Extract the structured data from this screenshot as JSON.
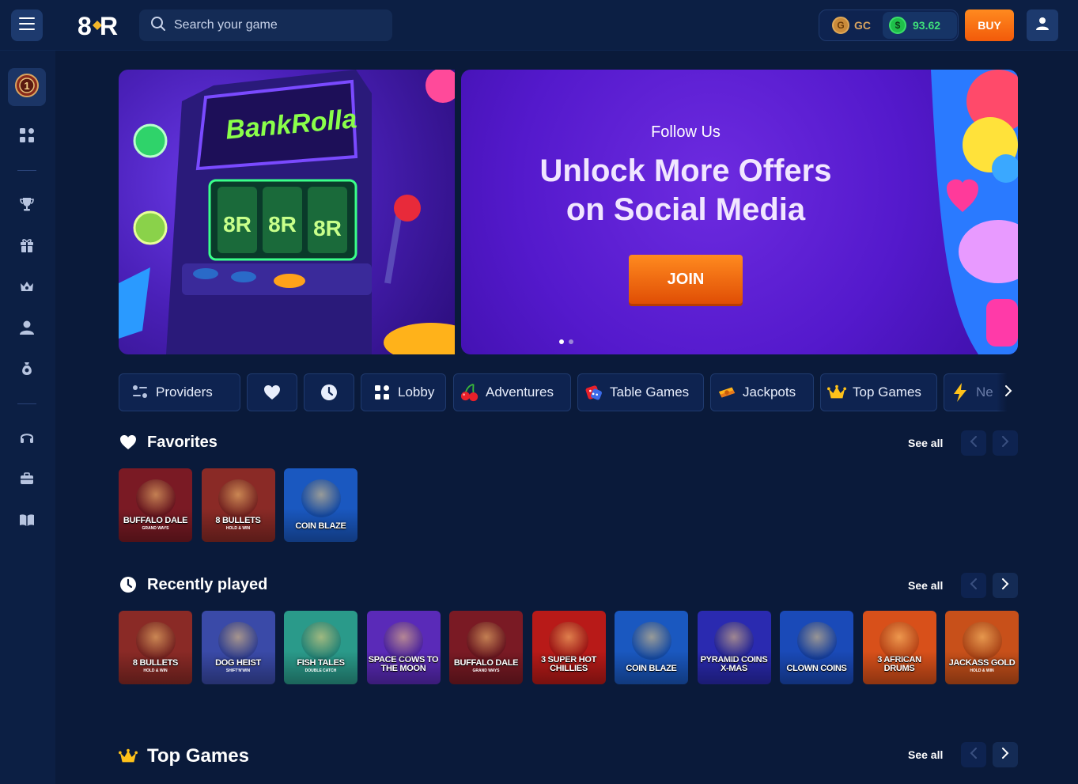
{
  "header": {
    "search_placeholder": "Search your game",
    "gc_label": "GC",
    "sc_value": "93.62",
    "buy_label": "BUY",
    "logo_text": "8R"
  },
  "sidebar": {
    "icons": [
      "vip-badge-icon",
      "grid-icon",
      "trophy-icon",
      "gift-icon",
      "crown-basket-icon",
      "user-icon",
      "money-bag-icon",
      "headset-icon",
      "briefcase-icon",
      "book-icon"
    ]
  },
  "banner": {
    "left_title": "BankRolla",
    "follow": "Follow Us",
    "headline_line1": "Unlock More Offers",
    "headline_line2": "on Social Media",
    "join_label": "JOIN"
  },
  "tabs": [
    {
      "label": "Providers",
      "icon": "providers-icon"
    },
    {
      "label": "",
      "icon": "heart-icon"
    },
    {
      "label": "",
      "icon": "clock-icon"
    },
    {
      "label": "Lobby",
      "icon": "grid-icon"
    },
    {
      "label": "Adventures",
      "icon": "cherries-icon"
    },
    {
      "label": "Table Games",
      "icon": "dice-icon"
    },
    {
      "label": "Jackpots",
      "icon": "cash-icon"
    },
    {
      "label": "Top Games",
      "icon": "crown-icon"
    },
    {
      "label": "Ne",
      "icon": "lightning-icon"
    }
  ],
  "favorites": {
    "title": "Favorites",
    "see_all": "See all",
    "games": [
      {
        "name": "BUFFALO DALE",
        "sub": "GRAND WAYS",
        "bg": "#7a1a24"
      },
      {
        "name": "8 BULLETS",
        "sub": "HOLD & WIN",
        "bg": "#8a2a26"
      },
      {
        "name": "COIN BLAZE",
        "sub": "",
        "bg": "#1a58c0"
      }
    ]
  },
  "recent": {
    "title": "Recently played",
    "see_all": "See all",
    "games": [
      {
        "name": "8 BULLETS",
        "sub": "HOLD & WIN",
        "bg": "#8a2a26"
      },
      {
        "name": "DOG HEIST",
        "sub": "SHIFT'N'WIN",
        "bg": "#3a4aa8"
      },
      {
        "name": "FISH TALES",
        "sub": "DOUBLE CATCH",
        "bg": "#2a9a8a"
      },
      {
        "name": "SPACE COWS TO THE MOON",
        "sub": "",
        "bg": "#5a2ab8"
      },
      {
        "name": "BUFFALO DALE",
        "sub": "GRAND WAYS",
        "bg": "#7a1a24"
      },
      {
        "name": "3 SUPER HOT CHILLIES",
        "sub": "",
        "bg": "#b81a18"
      },
      {
        "name": "COIN BLAZE",
        "sub": "",
        "bg": "#1a58c0"
      },
      {
        "name": "PYRAMID COINS X-MAS",
        "sub": "",
        "bg": "#2a2ab0"
      },
      {
        "name": "CLOWN COINS",
        "sub": "",
        "bg": "#1a4ab8"
      },
      {
        "name": "3 AFRICAN DRUMS",
        "sub": "",
        "bg": "#d8501a"
      },
      {
        "name": "JACKASS GOLD",
        "sub": "HOLD & WIN",
        "bg": "#c8501a"
      }
    ]
  },
  "top_games": {
    "title": "Top Games",
    "see_all": "See all"
  },
  "colors": {
    "background": "#0a1a3a",
    "panel": "#0c1f44",
    "accent_orange": "#ff8a1f",
    "sc_green": "#3fe07a",
    "gc_gold": "#d9a460"
  }
}
